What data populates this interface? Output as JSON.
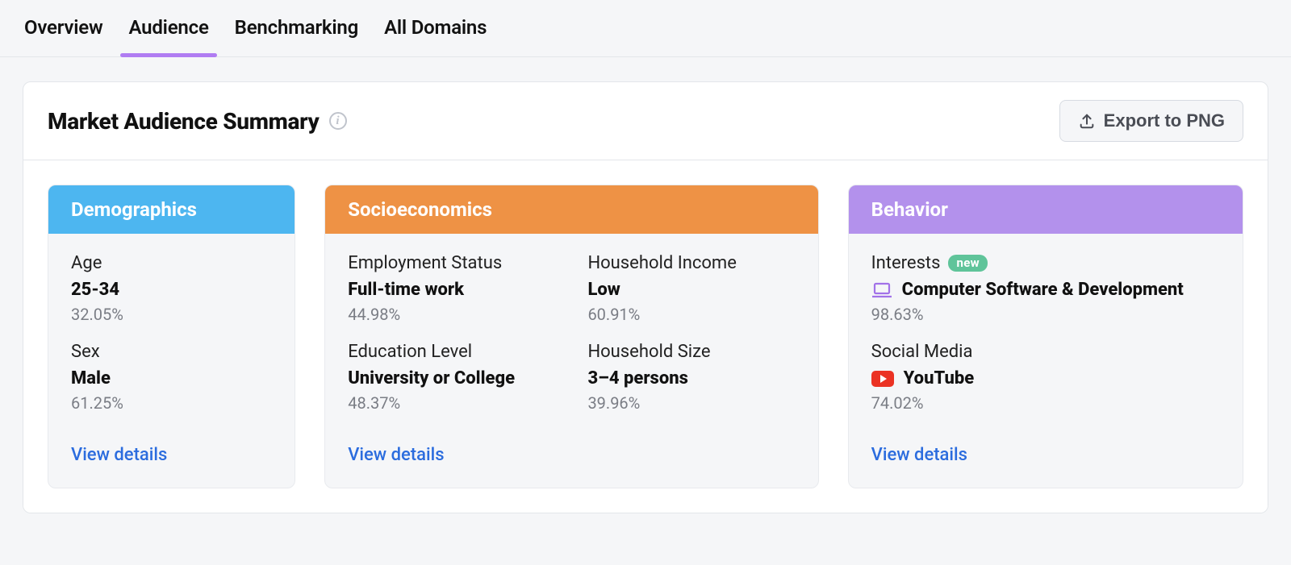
{
  "tabs": {
    "overview": "Overview",
    "audience": "Audience",
    "benchmarking": "Benchmarking",
    "all_domains": "All Domains"
  },
  "panel": {
    "title": "Market Audience Summary",
    "export_label": "Export to PNG"
  },
  "view_details_label": "View details",
  "cards": {
    "demographics": {
      "header": "Demographics",
      "header_color": "#4db6f0",
      "age_label": "Age",
      "age_value": "25-34",
      "age_pct": "32.05%",
      "sex_label": "Sex",
      "sex_value": "Male",
      "sex_pct": "61.25%"
    },
    "socio": {
      "header": "Socioeconomics",
      "header_color": "#ee9245",
      "employment_label": "Employment Status",
      "employment_value": "Full-time work",
      "employment_pct": "44.98%",
      "education_label": "Education Level",
      "education_value": "University or College",
      "education_pct": "48.37%",
      "income_label": "Household Income",
      "income_value": "Low",
      "income_pct": "60.91%",
      "size_label": "Household Size",
      "size_value": "3–4 persons",
      "size_pct": "39.96%"
    },
    "behavior": {
      "header": "Behavior",
      "header_color": "#b391ec",
      "interests_label": "Interests",
      "interests_badge": "new",
      "interests_value": "Computer Software & Development",
      "interests_pct": "98.63%",
      "social_label": "Social Media",
      "social_value": "YouTube",
      "social_pct": "74.02%"
    }
  }
}
